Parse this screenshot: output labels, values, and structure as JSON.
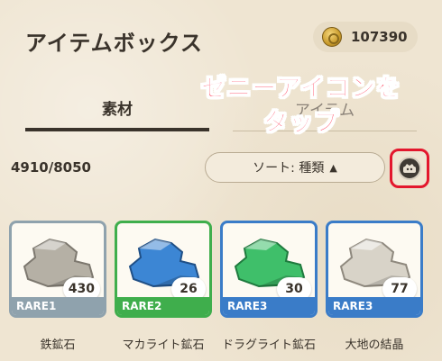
{
  "header": {
    "title": "アイテムボックス",
    "currency_value": "107390",
    "currency_icon": "zeny-coin-icon"
  },
  "tabs": [
    {
      "label": "素材",
      "active": true
    },
    {
      "label": "アイテム",
      "active": false
    }
  ],
  "annotation": {
    "line1": "ゼニーアイコンを",
    "line2": "タップ",
    "color": "#ff1a3a"
  },
  "toolbar": {
    "count": "4910/8050",
    "sort_label": "ソート: 種類",
    "sort_direction_icon": "▲",
    "zeny_button_icon": "zeny-icon"
  },
  "items": [
    {
      "name": "鉄鉱石",
      "quantity": "430",
      "rarity": "RARE1",
      "rarity_color": "#8fa2ad",
      "ore_color": "#b5b0a5"
    },
    {
      "name": "マカライト鉱石",
      "quantity": "26",
      "rarity": "RARE2",
      "rarity_color": "#3fae4c",
      "ore_color": "#3c86d4"
    },
    {
      "name": "ドラグライト鉱石",
      "quantity": "30",
      "rarity": "RARE3",
      "rarity_color": "#3a7cc8",
      "ore_color": "#3fbf6a"
    },
    {
      "name": "大地の結晶",
      "quantity": "77",
      "rarity": "RARE3",
      "rarity_color": "#3a7cc8",
      "ore_color": "#d8d3c8"
    }
  ]
}
